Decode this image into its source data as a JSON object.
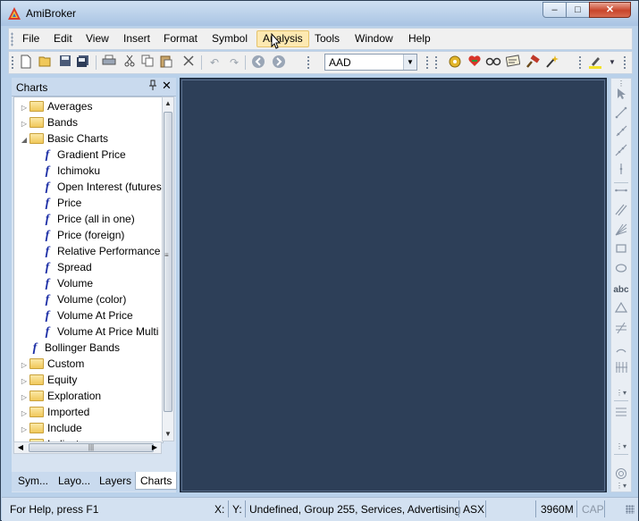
{
  "window": {
    "title": "AmiBroker",
    "min_glyph": "–",
    "max_glyph": "□",
    "close_glyph": "✕"
  },
  "menu": {
    "items": [
      "File",
      "Edit",
      "View",
      "Insert",
      "Format",
      "Symbol",
      "Analysis",
      "Tools",
      "Window",
      "Help"
    ],
    "active": "Analysis"
  },
  "toolbar": {
    "symbol_value": "AAD",
    "icons": [
      "new-icon",
      "open-icon",
      "save-icon",
      "save-all-icon",
      "print-icon",
      "cut-icon",
      "copy-icon",
      "paste-icon",
      "delete-icon",
      "undo-icon",
      "redo-icon",
      "back-icon",
      "forward-icon",
      "symbol-combo",
      "settings-icon",
      "heart-icon",
      "glasses-icon",
      "scan-icon",
      "hammer-icon",
      "wand-icon",
      "highlighter-icon"
    ]
  },
  "charts_panel": {
    "title": "Charts",
    "tree": [
      {
        "label": "Averages",
        "type": "folder",
        "level": 0,
        "state": "collapsed"
      },
      {
        "label": "Bands",
        "type": "folder",
        "level": 0,
        "state": "collapsed"
      },
      {
        "label": "Basic Charts",
        "type": "folder",
        "level": 0,
        "state": "expanded"
      },
      {
        "label": "Gradient Price",
        "type": "formula",
        "level": 1
      },
      {
        "label": "Ichimoku",
        "type": "formula",
        "level": 1
      },
      {
        "label": "Open Interest (futures",
        "type": "formula",
        "level": 1
      },
      {
        "label": "Price",
        "type": "formula",
        "level": 1
      },
      {
        "label": "Price (all in one)",
        "type": "formula",
        "level": 1
      },
      {
        "label": "Price (foreign)",
        "type": "formula",
        "level": 1
      },
      {
        "label": "Relative Performance",
        "type": "formula",
        "level": 1
      },
      {
        "label": "Spread",
        "type": "formula",
        "level": 1
      },
      {
        "label": "Volume",
        "type": "formula",
        "level": 1
      },
      {
        "label": "Volume (color)",
        "type": "formula",
        "level": 1
      },
      {
        "label": "Volume At Price",
        "type": "formula",
        "level": 1
      },
      {
        "label": "Volume At Price Multi",
        "type": "formula",
        "level": 1
      },
      {
        "label": "Bollinger Bands",
        "type": "formula",
        "level": 0
      },
      {
        "label": "Custom",
        "type": "folder",
        "level": 0,
        "state": "collapsed"
      },
      {
        "label": "Equity",
        "type": "folder",
        "level": 0,
        "state": "collapsed"
      },
      {
        "label": "Exploration",
        "type": "folder",
        "level": 0,
        "state": "collapsed"
      },
      {
        "label": "Imported",
        "type": "folder",
        "level": 0,
        "state": "collapsed"
      },
      {
        "label": "Include",
        "type": "folder",
        "level": 0,
        "state": "collapsed"
      },
      {
        "label": "Indicators",
        "type": "folder",
        "level": 0,
        "state": "collapsed"
      }
    ],
    "tabs": [
      "Sym...",
      "Layo...",
      "Layers",
      "Charts"
    ],
    "active_tab": "Charts"
  },
  "drawing_tools": [
    "pointer-icon",
    "line-icon",
    "ray-icon",
    "extended-line-icon",
    "vertical-line-icon",
    "horizontal-line-icon",
    "parallel-lines-icon",
    "fibonacci-fan-icon",
    "rectangle-icon",
    "ellipse-icon",
    "text-tool-icon",
    "triangle-icon",
    "cycles-icon",
    "arc-icon",
    "fibonacci-timezones-icon",
    "more-tools-icon",
    "fibonacci-retracement-icon",
    "more-tools-icon-2",
    "target-icon"
  ],
  "drawing_labels": {
    "text_tool": "abc"
  },
  "statusbar": {
    "help": "For Help, press F1",
    "x_label": "X:",
    "y_label": "Y:",
    "symbol_info": "Undefined, Group 255, Services, Advertising",
    "exchange": "ASX",
    "memory": "3960M",
    "caps": "CAP"
  },
  "colors": {
    "chart_background": "#2d3f58",
    "window_frame": "#b9d1ea",
    "menu_highlight": "#fde9b1"
  }
}
